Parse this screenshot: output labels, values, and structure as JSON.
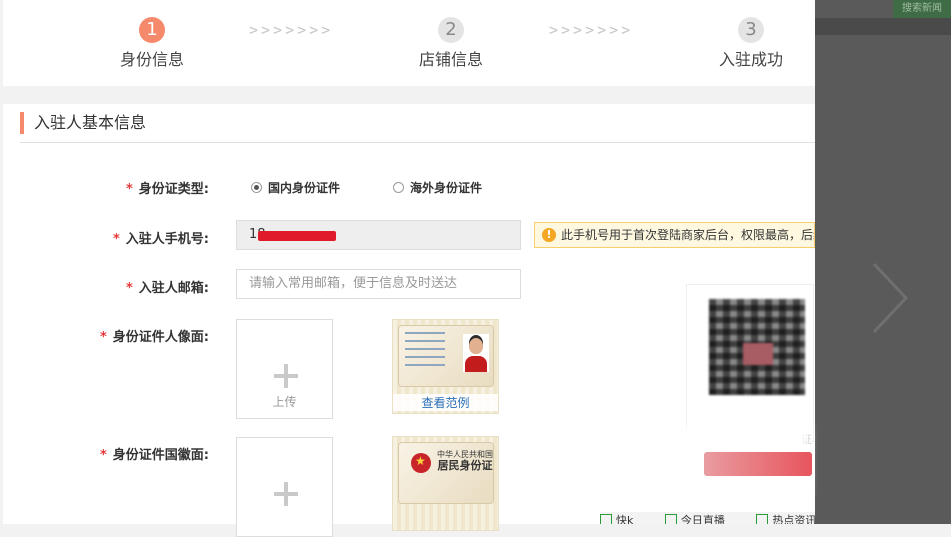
{
  "steps": [
    {
      "number": "1",
      "label": "身份信息",
      "state": "active"
    },
    {
      "number": "2",
      "label": "店铺信息",
      "state": "inactive"
    },
    {
      "number": "3",
      "label": "入驻成功",
      "state": "inactive"
    }
  ],
  "step_separator": ">>>>>>>",
  "section": {
    "title": "入驻人基本信息"
  },
  "form": {
    "id_type": {
      "required_mark": "*",
      "label": "身份证类型:",
      "options": [
        {
          "label": "国内身份证件",
          "checked": true
        },
        {
          "label": "海外身份证件",
          "checked": false
        }
      ]
    },
    "phone": {
      "required_mark": "*",
      "label": "入驻人手机号:",
      "value_prefix": "18",
      "tip": "此手机号用于首次登陆商家后台，权限最高，后续可以"
    },
    "email": {
      "required_mark": "*",
      "label": "入驻人邮箱:",
      "placeholder": "请输入常用邮箱，便于信息及时送达"
    },
    "portrait": {
      "required_mark": "*",
      "label": "身份证件人像面:",
      "upload_text": "上传",
      "sample_link": "查看范例"
    },
    "emblem": {
      "required_mark": "*",
      "label": "身份证件国徽面:",
      "card_country": "中华人民共和国",
      "card_name": "居民身份证"
    }
  },
  "overlay": {
    "top_button": "搜索新闻",
    "qr_caption": "证"
  },
  "bottombar": {
    "items": [
      "快k",
      "今日直播",
      "热点资讯"
    ]
  },
  "colors": {
    "accent": "#f4896b",
    "required": "#e4393c",
    "link": "#2a6fb8",
    "tip_bg": "#fff8e1",
    "tip_icon": "#f5a623"
  }
}
